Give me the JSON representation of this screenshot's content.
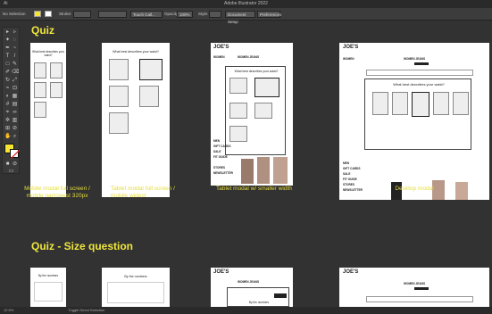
{
  "app": {
    "title": "Adobe Illustrator 2022",
    "menu": "Ai"
  },
  "control_bar": {
    "selection": "No Selection",
    "stroke_label": "Stroke:",
    "brush": "Touch Call...",
    "opacity_label": "Opacity:",
    "opacity_value": "100%",
    "style_label": "Style:",
    "doc_setup": "Document Setup",
    "preferences": "Preferences"
  },
  "sections": [
    {
      "title": "Quiz"
    },
    {
      "title": "Quiz - Size question"
    }
  ],
  "captions": [
    "Mobile modal full screen / mobile narrowest 320px",
    "Tablet modal full screen / mobile widest",
    "Tablet modal w/ smaller width",
    "Desktop modal"
  ],
  "artboard_text": {
    "question": "What best describes your waist?",
    "question2": "What best describes your waist?",
    "by_numbers": "By the numbers",
    "brand": "JOE'S",
    "brand_suffix": "JEANS",
    "women_jeans": "WOMEN JEANS",
    "women": "WOMEN",
    "men": "MEN",
    "sale": "SALE",
    "stores": "STORES",
    "newsletter": "NEWSLETTER",
    "gift_cards": "GIFT CARDS",
    "fit_guide": "FIT GUIDE"
  },
  "status": {
    "zoom": "12.5%",
    "info": "Toggle Direct Selection"
  },
  "colors": {
    "accent": "#f0e63c",
    "fill": "#f5e532",
    "background": "#323232"
  }
}
